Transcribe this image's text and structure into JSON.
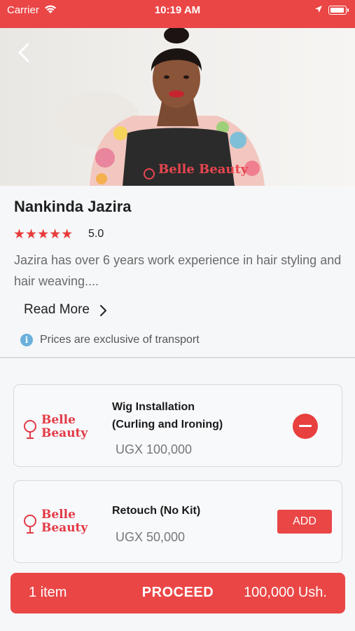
{
  "status_bar": {
    "carrier": "Carrier",
    "time": "10:19 AM"
  },
  "profile": {
    "name": "Nankinda Jazira",
    "stars": "★★★★★",
    "rating": "5.0",
    "bio": "Jazira has over 6 years work experience in hair styling and hair weaving....",
    "read_more_label": "Read More",
    "apron_text": "Belle Beauty"
  },
  "notice": {
    "icon": "info-icon",
    "text": "Prices are exclusive of transport"
  },
  "services": [
    {
      "logo_text": "Belle Beauty",
      "title_line1": "Wig Installation",
      "title_line2": "(Curling and Ironing)",
      "price": "UGX 100,000",
      "action": "remove"
    },
    {
      "logo_text": "Belle Beauty",
      "title_line1": "Retouch (No Kit)",
      "price": "UGX 50,000",
      "action_label": "ADD"
    }
  ],
  "checkout": {
    "count_label": "1 item",
    "proceed_label": "PROCEED",
    "total_label": "100,000 Ush."
  },
  "colors": {
    "accent": "#ea4646",
    "info": "#6ab0dc"
  }
}
